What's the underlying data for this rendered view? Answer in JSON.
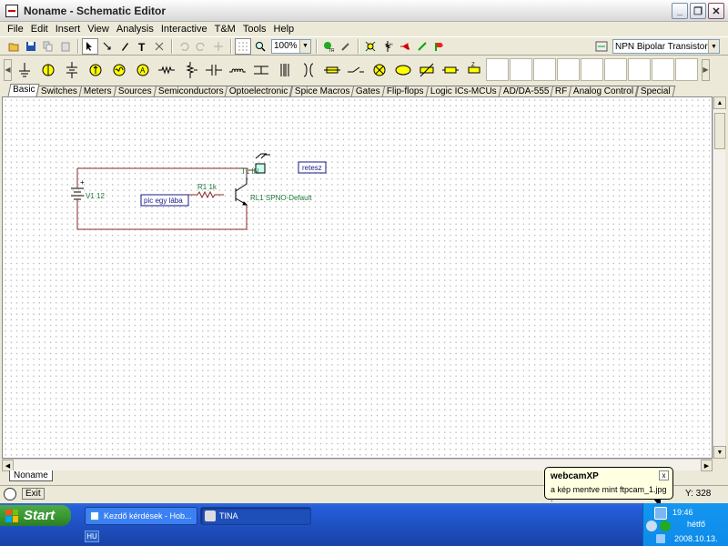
{
  "window": {
    "title": "Noname - Schematic Editor",
    "buttons": [
      "minimize",
      "maximize",
      "close"
    ]
  },
  "menu": [
    "File",
    "Edit",
    "Insert",
    "View",
    "Analysis",
    "Interactive",
    "T&M",
    "Tools",
    "Help"
  ],
  "toolbar": {
    "zoom": "100%",
    "component_select": "NPN Bipolar Transistor"
  },
  "component_tabs": [
    "Basic",
    "Switches",
    "Meters",
    "Sources",
    "Semiconductors",
    "Optoelectronic",
    "Spice Macros",
    "Gates",
    "Flip-flops",
    "Logic ICs-MCUs",
    "AD/DA-555",
    "RF",
    "Analog Control",
    "Special"
  ],
  "active_tab": "Basic",
  "schematic": {
    "battery_label": "V1 12",
    "battery_plus": "+",
    "resistor_label": "R1 1k",
    "relay_label": "RL1 SPNO-Default",
    "relay_coil_label": "T1 IN",
    "note_pic": "pic egy lába",
    "note_retesz": "retesz"
  },
  "document_tab": "Noname",
  "status": {
    "exit": "Exit",
    "coord": "Y: 328"
  },
  "notification": {
    "title": "webcamXP",
    "message": "a kép mentve mint ftpcam_1.jpg ."
  },
  "taskbar": {
    "start": "Start",
    "tasks": [
      "Kezdő kérdések - Hob...",
      "TINA"
    ],
    "language": "HU",
    "time": "19:46",
    "day": "hétfő",
    "date": "2008.10.13."
  }
}
